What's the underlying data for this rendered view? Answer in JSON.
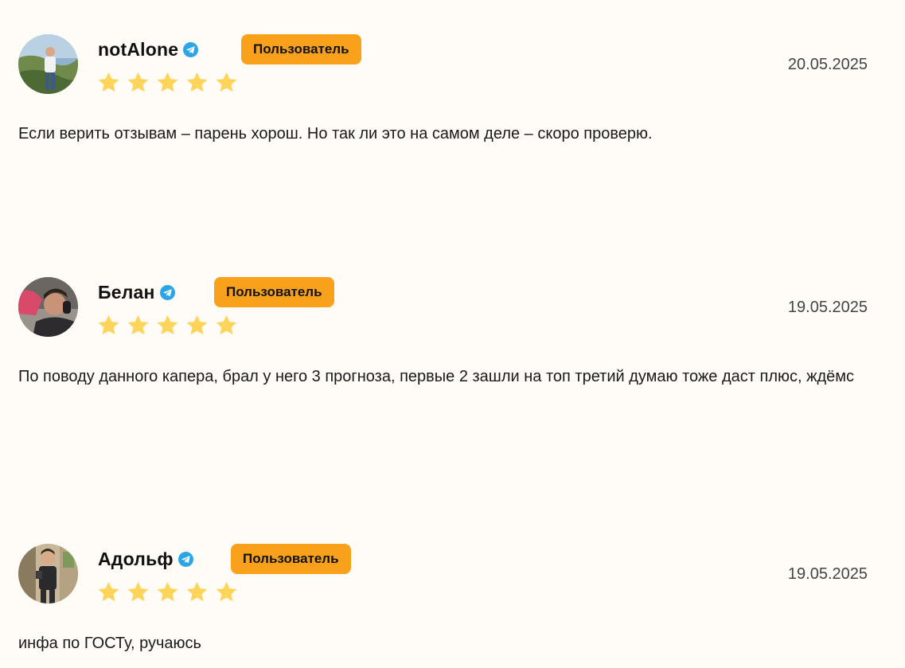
{
  "reviews": [
    {
      "name": "notAlone",
      "badge": "Пользователь",
      "rating_stars": 5,
      "date": "20.05.2025",
      "text": "Если верить отзывам – парень хорош. Но так ли это на самом деле – скоро проверю."
    },
    {
      "name": "Белан",
      "badge": "Пользователь",
      "rating_stars": 5,
      "date": "19.05.2025",
      "text": "По поводу данного капера, брал у него 3 прогноза, первые 2 зашли на топ третий думаю тоже даст плюс, ждёмс"
    },
    {
      "name": "Адольф",
      "badge": "Пользователь",
      "rating_stars": 5,
      "date": "19.05.2025",
      "text": "инфа по ГОСТу, ручаюсь"
    }
  ],
  "colors": {
    "background": "#fffbf7",
    "badge": "#f9a11b",
    "star": "#ffd45a",
    "verified": "#2aa6e8"
  },
  "icons": {
    "verified": "telegram-verified-icon",
    "star": "star-icon"
  }
}
